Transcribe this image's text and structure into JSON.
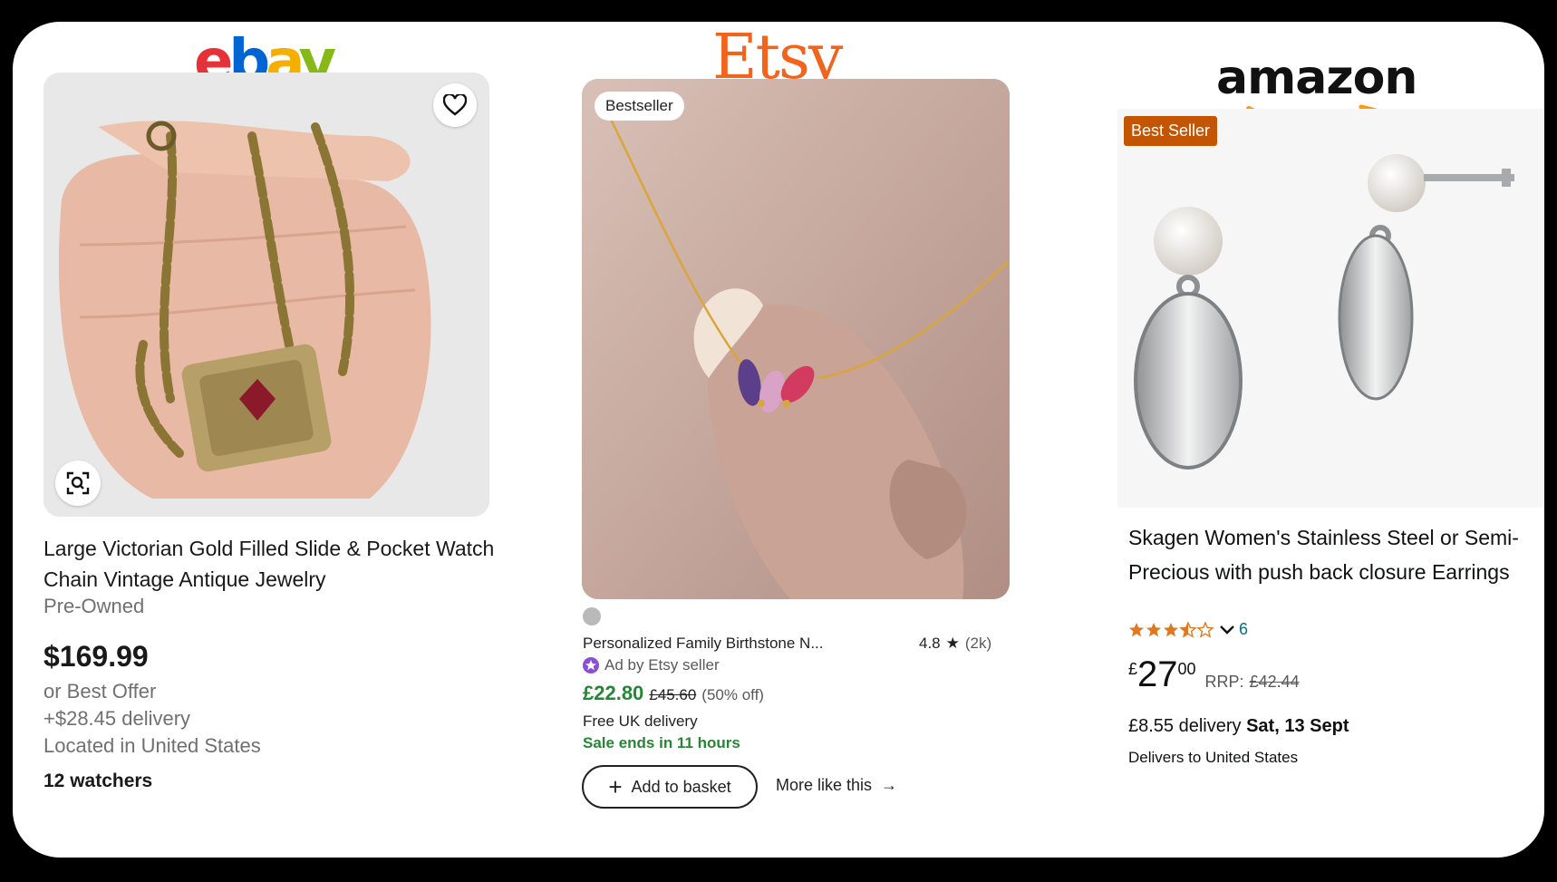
{
  "ebay": {
    "logo": {
      "e": "e",
      "b": "b",
      "a": "a",
      "y": "y"
    },
    "logo_colors": [
      "#e53238",
      "#0064d2",
      "#f5af02",
      "#86b817"
    ],
    "title": "Large Victorian Gold Filled Slide & Pocket Watch Chain Vintage Antique Jewelry",
    "condition": "Pre-Owned",
    "price": "$169.99",
    "best_offer": "or Best Offer",
    "delivery": "+$28.45 delivery",
    "location": "Located in United States",
    "watchers": "12 watchers",
    "icons": [
      "heart-icon",
      "visual-search-icon"
    ]
  },
  "etsy": {
    "logo": "Etsy",
    "badge": "Bestseller",
    "title": "Personalized Family Birthstone N...",
    "rating": "4.8",
    "rating_count": "(2k)",
    "ad_label": "Ad by Etsy seller",
    "price": "£22.80",
    "old_price": "£45.60",
    "discount": "(50% off)",
    "free_delivery": "Free UK delivery",
    "sale_ends": "Sale ends in 11 hours",
    "add_button": "Add to basket",
    "more_like": "More like this",
    "accent": "#f1641e",
    "sale_color": "#258635"
  },
  "amazon": {
    "logo": "amazon",
    "badge": "Best Seller",
    "title": "Skagen Women's Stainless Steel or Semi- Precious with push back closure Earrings",
    "stars": 3.5,
    "review_count": "6",
    "price_currency": "£",
    "price_whole": "27",
    "price_fraction": "00",
    "rrp_label": "RRP:",
    "rrp_value": "£42.44",
    "delivery_cost": "£8.55 delivery",
    "delivery_date": "Sat, 13 Sept",
    "delivers_to": "Delivers to United States",
    "badge_color": "#c45500",
    "star_color": "#de7921"
  }
}
